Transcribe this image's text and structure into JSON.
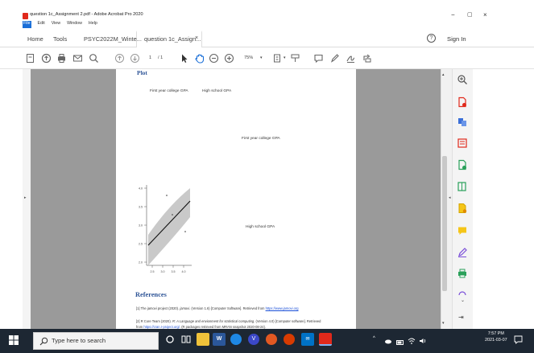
{
  "window": {
    "title": "question 1c_Assignment 2.pdf - Adobe Acrobat Pro 2020",
    "minimize": "−",
    "maximize": "▢",
    "close": "×"
  },
  "menu": [
    "File",
    "Edit",
    "View",
    "Window",
    "Help"
  ],
  "tabs": {
    "home": "Home",
    "tools": "Tools",
    "doc1": "PSYC2022M_Winte...",
    "doc2": "question 1c_Assign...",
    "doc2_close": "×",
    "help": "?",
    "signin": "Sign In"
  },
  "toolbar": {
    "page_current": "1",
    "page_sep": "/ 1",
    "zoom": "75%"
  },
  "pdf": {
    "heading_plot": "Plot",
    "col_label_1": "First year college GPA",
    "col_label_2": "High school GPA",
    "diag_label_1": "First year college GPA",
    "diag_label_2": "High school GPA",
    "y_ticks": [
      "4.0",
      "3.5",
      "3.0",
      "2.5",
      "2.0"
    ],
    "x_ticks": [
      "2.5",
      "3.0",
      "3.5",
      "4.0"
    ],
    "heading_refs": "References",
    "ref1_a": "[1] The jamovi project (2020).",
    "ref1_b": "jamovi.",
    "ref1_c": "(Version 1.6) [Computer Software]. Retrieved from",
    "ref1_link": "https://www.jamovi.org",
    "ref2_a": "[2] R Core Team (2020).",
    "ref2_b": "R: A Language and envionment for statistical computing.",
    "ref2_c": "(Version 4.0) [Computer software]. Retrieved",
    "ref2_d": "from",
    "ref2_link": "https://cran.r-project.org/",
    "ref2_e": ". (R packages retrieved from MRAN snapshot 2020-08-24)."
  },
  "taskbar": {
    "search_placeholder": "Type here to search",
    "time": "7:57 PM",
    "date": "2021-03-07"
  },
  "colors": {
    "accent_blue": "#1a6fd8",
    "acrobat_red": "#e0291b",
    "heading_blue": "#2f5597",
    "taskbar": "#1d2733"
  }
}
